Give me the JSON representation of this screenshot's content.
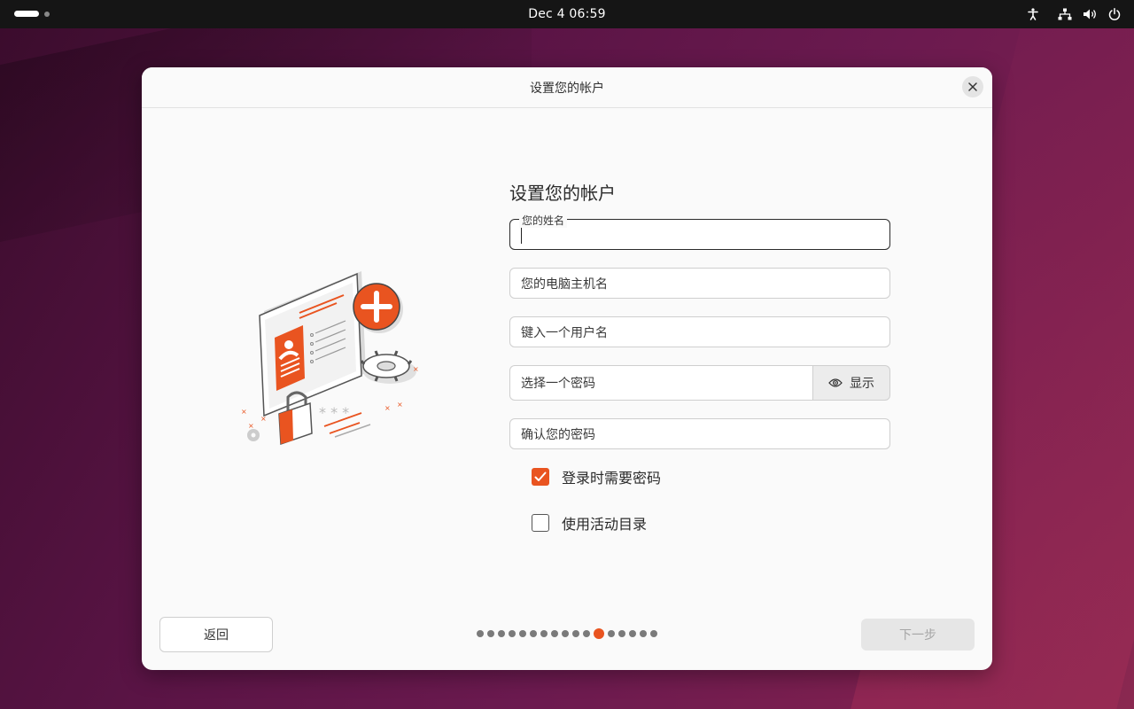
{
  "topbar": {
    "clock": "Dec 4  06:59"
  },
  "dialog": {
    "title": "设置您的帐户",
    "close_icon": "close-icon"
  },
  "form": {
    "heading": "设置您的帐户",
    "name_label": "您的姓名",
    "hostname_placeholder": "您的电脑主机名",
    "username_placeholder": "键入一个用户名",
    "password_placeholder": "选择一个密码",
    "show_label": "显示",
    "confirm_placeholder": "确认您的密码",
    "require_password_label": "登录时需要密码",
    "require_password_checked": true,
    "active_directory_label": "使用活动目录",
    "active_directory_checked": false
  },
  "nav": {
    "back_label": "返回",
    "next_label": "下一步",
    "steps_total": 17,
    "current_step": 12
  },
  "colors": {
    "accent": "#e95420"
  }
}
